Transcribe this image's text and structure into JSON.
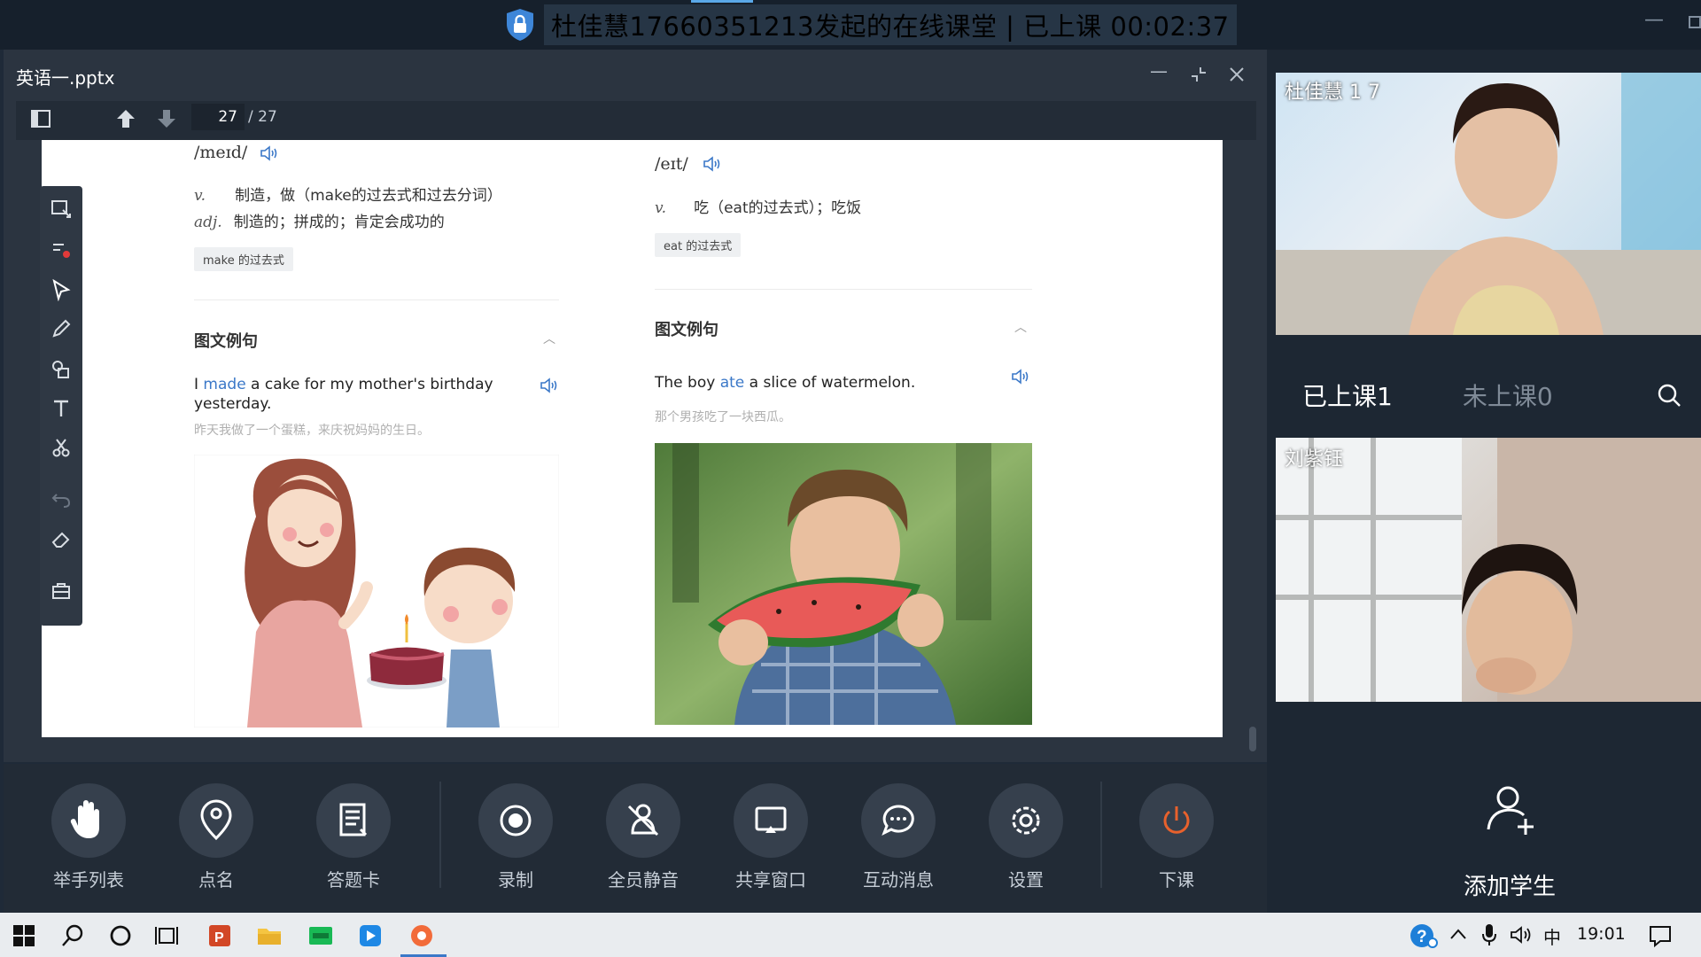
{
  "window": {
    "title": "杜佳慧17660351213发起的在线课堂 | 已上课 00:02:37"
  },
  "ppt": {
    "file_name": "英语一.pptx",
    "page_current": "27",
    "page_total": "/ 27"
  },
  "slide": {
    "left": {
      "phonetic": "/meɪd/",
      "defs": [
        {
          "pos": "v.",
          "text": "制造，做（make的过去式和过去分词）"
        },
        {
          "pos": "adj.",
          "text": "制造的；拼成的；肯定会成功的"
        }
      ],
      "tag": "make 的过去式",
      "section_title": "图文例句",
      "sentence_pre": "I ",
      "sentence_hl": "made",
      "sentence_post": " a cake for my mother's birthday yesterday.",
      "translation": "昨天我做了一个蛋糕，来庆祝妈妈的生日。"
    },
    "right": {
      "phonetic": "/eɪt/",
      "defs": [
        {
          "pos": "v.",
          "text": "吃（eat的过去式）；吃饭"
        }
      ],
      "tag": "eat 的过去式",
      "section_title": "图文例句",
      "sentence_pre": "The boy ",
      "sentence_hl": "ate",
      "sentence_post": " a slice of watermelon.",
      "translation": "那个男孩吃了一块西瓜。"
    }
  },
  "controls": [
    {
      "label": "举手列表",
      "icon": "raise-hand-icon"
    },
    {
      "label": "点名",
      "icon": "location-pin-icon"
    },
    {
      "label": "答题卡",
      "icon": "answer-card-icon"
    },
    {
      "label": "录制",
      "icon": "record-icon"
    },
    {
      "label": "全员静音",
      "icon": "mute-all-icon"
    },
    {
      "label": "共享窗口",
      "icon": "share-window-icon"
    },
    {
      "label": "互动消息",
      "icon": "chat-bubble-icon"
    },
    {
      "label": "设置",
      "icon": "gear-icon"
    },
    {
      "label": "下课",
      "icon": "power-icon"
    }
  ],
  "side": {
    "video1_name": "杜佳慧 1 7",
    "video2_name": "刘紫钰",
    "tab_active": "已上课1",
    "tab_inactive": "未上课0",
    "add_student": "添加学生"
  },
  "taskbar": {
    "ime": "中",
    "time": "19:01"
  },
  "colors": {
    "accent": "#3b78c8",
    "end_class": "#e8612c"
  }
}
